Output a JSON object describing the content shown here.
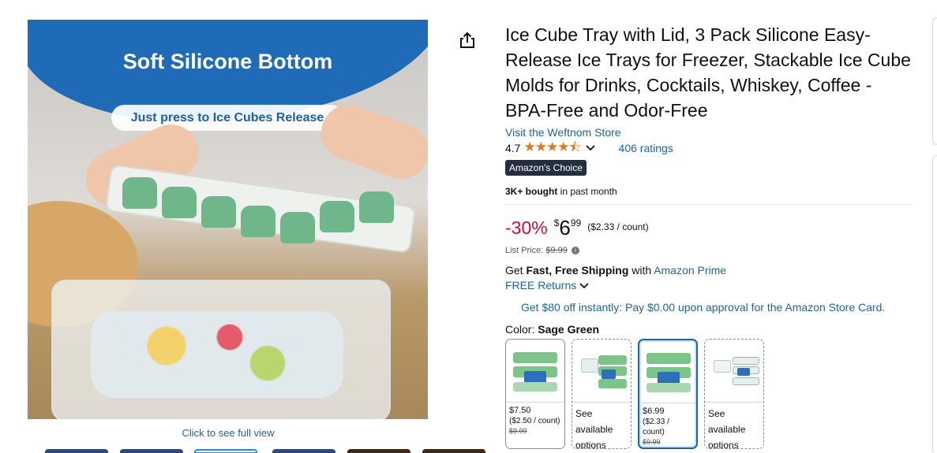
{
  "image": {
    "headline": "Soft Silicone Bottom",
    "subheadline": "Just press to Ice Cubes Release",
    "full_view_link": "Click to see full view"
  },
  "share_icon": "share-icon",
  "product": {
    "title": "Ice Cube Tray with Lid, 3 Pack Silicone Easy-Release Ice Trays for Freezer, Stackable Ice Cube Molds for Drinks, Cocktails, Whiskey, Coffee - BPA-Free and Odor-Free",
    "store_link": "Visit the Weftnom Store",
    "rating": "4.7",
    "stars": "★★★★⯪",
    "ratings_count": "406 ratings",
    "badge": "Amazon's Choice",
    "bought_bold": "3K+ bought",
    "bought_rest": " in past month"
  },
  "price": {
    "discount": "-30%",
    "currency": "$",
    "whole": "6",
    "fraction": "99",
    "unit_price": "($2.33 / count)",
    "list_price_label": "List Price: ",
    "list_price": "$9.99"
  },
  "shipping": {
    "prefix": "Get ",
    "fast": "Fast, Free Shipping",
    "with": " with ",
    "prime_link": "Amazon Prime",
    "returns": "FREE Returns"
  },
  "card_offer": "Get $80 off instantly: Pay $0.00 upon approval for the Amazon Store Card.",
  "color": {
    "label": "Color: ",
    "value": "Sage Green"
  },
  "swatches": [
    {
      "price": "$7.50",
      "unit": "($2.50 / count)",
      "list": "$9.99"
    },
    {
      "see": "See available options"
    },
    {
      "price": "$6.99",
      "unit": "($2.33 / count)",
      "list": "$9.99"
    },
    {
      "see": "See available options"
    }
  ],
  "colors": {
    "link": "#2162a1",
    "discount": "#cc0c39",
    "star": "#de7921",
    "badge_bg": "#232f3e",
    "banner_blue": "#1f6bb8"
  }
}
